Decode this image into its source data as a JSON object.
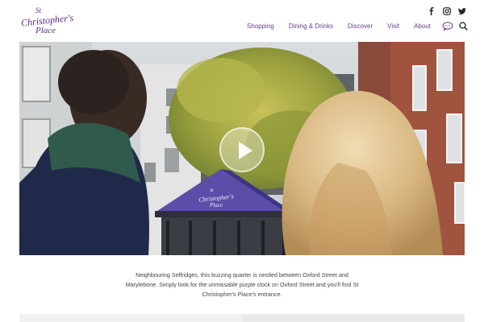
{
  "brand": {
    "logo_text_line1": "St",
    "logo_text_line2": "Christopher's",
    "logo_text_line3": "Place",
    "accent_color": "#6a3d8c"
  },
  "social": [
    {
      "name": "facebook-icon"
    },
    {
      "name": "instagram-icon"
    },
    {
      "name": "twitter-icon"
    }
  ],
  "nav": {
    "items": [
      {
        "label": "Shopping"
      },
      {
        "label": "Dining & Drinks"
      },
      {
        "label": "Discover"
      },
      {
        "label": "Visit"
      },
      {
        "label": "About"
      }
    ],
    "extra_icon": "speech-bubble-icon",
    "search_icon": "search-icon"
  },
  "hero": {
    "sign_line1": "St",
    "sign_line2": "Christopher's",
    "sign_line3": "Place",
    "play_icon": "play-icon"
  },
  "intro": {
    "text": "Neighbouring Selfridges, this buzzing quarter is nestled between Oxford Street and Marylebone. Simply look for the unmissable purple clock on Oxford Street and you'll find St Christopher's Place's entrance."
  }
}
